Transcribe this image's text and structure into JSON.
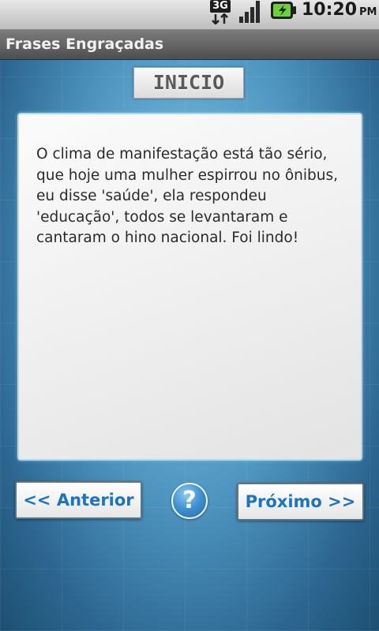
{
  "status_bar": {
    "network_type": "3G",
    "time": "10:20",
    "am_pm": "PM",
    "icons": {
      "network": "network-3g-icon",
      "signal": "signal-strength-icon",
      "battery": "battery-charging-icon"
    },
    "colors": {
      "battery_fill": "#6ad13a",
      "background": "#d9d9d9"
    }
  },
  "app": {
    "title": "Frases Engraçadas"
  },
  "header_label": "INICIO",
  "phrase": {
    "text": "O clima de manifestação está tão sério, que hoje uma mulher espirrou no ônibus, eu disse 'saúde', ela respondeu 'educação', todos se levantaram e cantaram o hino nacional. Foi lindo!"
  },
  "buttons": {
    "previous_label": "<< Anterior",
    "help_label": "?",
    "next_label": "Próximo >>"
  },
  "colors": {
    "button_text": "#1a73c4",
    "background_blue": "#4f97c2"
  }
}
